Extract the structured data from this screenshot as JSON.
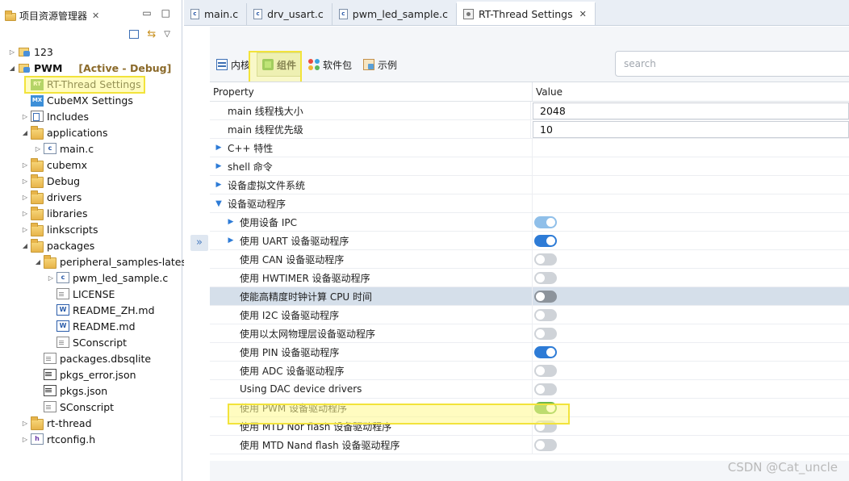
{
  "explorer": {
    "title": "项目资源管理器",
    "tree": [
      {
        "label": "123",
        "icon": "project-icon",
        "level": 0,
        "twisty": "▷"
      },
      {
        "label": "PWM",
        "icon": "project-icon",
        "level": 0,
        "twisty": "◢",
        "decoration": "[Active - Debug]",
        "bold": true
      },
      {
        "label": "RT-Thread Settings",
        "icon": "rt-thread-settings-icon",
        "level": 1,
        "twisty": ""
      },
      {
        "label": "CubeMX Settings",
        "icon": "cubemx-icon",
        "level": 1,
        "twisty": ""
      },
      {
        "label": "Includes",
        "icon": "includes-icon",
        "level": 1,
        "twisty": "▷"
      },
      {
        "label": "applications",
        "icon": "folder-icon",
        "level": 1,
        "twisty": "◢"
      },
      {
        "label": "main.c",
        "icon": "c-file-icon",
        "level": 2,
        "twisty": "▷"
      },
      {
        "label": "cubemx",
        "icon": "folder-icon",
        "level": 1,
        "twisty": "▷"
      },
      {
        "label": "Debug",
        "icon": "folder-icon",
        "level": 1,
        "twisty": "▷"
      },
      {
        "label": "drivers",
        "icon": "folder-icon",
        "level": 1,
        "twisty": "▷"
      },
      {
        "label": "libraries",
        "icon": "folder-icon",
        "level": 1,
        "twisty": "▷"
      },
      {
        "label": "linkscripts",
        "icon": "folder-icon",
        "level": 1,
        "twisty": "▷"
      },
      {
        "label": "packages",
        "icon": "folder-icon",
        "level": 1,
        "twisty": "◢"
      },
      {
        "label": "peripheral_samples-latest",
        "icon": "folder-icon",
        "level": 2,
        "twisty": "◢"
      },
      {
        "label": "pwm_led_sample.c",
        "icon": "c-file-icon",
        "level": 3,
        "twisty": "▷"
      },
      {
        "label": "LICENSE",
        "icon": "document-icon",
        "level": 3,
        "twisty": ""
      },
      {
        "label": "README_ZH.md",
        "icon": "word-file-icon",
        "level": 3,
        "twisty": ""
      },
      {
        "label": "README.md",
        "icon": "word-file-icon",
        "level": 3,
        "twisty": ""
      },
      {
        "label": "SConscript",
        "icon": "document-icon",
        "level": 3,
        "twisty": ""
      },
      {
        "label": "packages.dbsqlite",
        "icon": "document-icon",
        "level": 2,
        "twisty": ""
      },
      {
        "label": "pkgs_error.json",
        "icon": "json-file-icon",
        "level": 2,
        "twisty": ""
      },
      {
        "label": "pkgs.json",
        "icon": "json-file-icon",
        "level": 2,
        "twisty": ""
      },
      {
        "label": "SConscript",
        "icon": "document-icon",
        "level": 2,
        "twisty": ""
      },
      {
        "label": "rt-thread",
        "icon": "folder-icon",
        "level": 1,
        "twisty": "▷"
      },
      {
        "label": "rtconfig.h",
        "icon": "h-file-icon",
        "level": 1,
        "twisty": "▷"
      }
    ]
  },
  "editor_tabs": [
    {
      "label": "main.c",
      "icon": "c-file-icon",
      "active": false
    },
    {
      "label": "drv_usart.c",
      "icon": "c-file-icon",
      "active": false
    },
    {
      "label": "pwm_led_sample.c",
      "icon": "c-file-icon",
      "active": false
    },
    {
      "label": "RT-Thread Settings",
      "icon": "settings-icon",
      "active": true
    }
  ],
  "categories": [
    {
      "label": "内核",
      "icon": "kernel-icon",
      "selected": false
    },
    {
      "label": "组件",
      "icon": "component-icon",
      "selected": true
    },
    {
      "label": "软件包",
      "icon": "package-icon",
      "selected": false
    },
    {
      "label": "示例",
      "icon": "example-icon",
      "selected": false
    }
  ],
  "search": {
    "placeholder": "search"
  },
  "grid": {
    "header": {
      "property": "Property",
      "value": "Value"
    },
    "rows": [
      {
        "label": "main 线程栈大小",
        "indent": 1,
        "expander": "",
        "value_type": "text",
        "value": "2048"
      },
      {
        "label": "main 线程优先级",
        "indent": 1,
        "expander": "",
        "value_type": "text",
        "value": "10"
      },
      {
        "label": "C++ 特性",
        "indent": 0,
        "expander": "▶",
        "value_type": "none"
      },
      {
        "label": "shell 命令",
        "indent": 0,
        "expander": "▶",
        "value_type": "none"
      },
      {
        "label": "设备虚拟文件系统",
        "indent": 0,
        "expander": "▶",
        "value_type": "none"
      },
      {
        "label": "设备驱动程序",
        "indent": 0,
        "expander": "▼",
        "value_type": "none"
      },
      {
        "label": "使用设备 IPC",
        "indent": 1,
        "expander": "▶",
        "value_type": "toggle",
        "state": "onlight"
      },
      {
        "label": "使用 UART 设备驱动程序",
        "indent": 1,
        "expander": "▶",
        "value_type": "toggle",
        "state": "on"
      },
      {
        "label": "使用 CAN 设备驱动程序",
        "indent": 1,
        "expander": "",
        "value_type": "toggle",
        "state": "off"
      },
      {
        "label": "使用 HWTIMER 设备驱动程序",
        "indent": 1,
        "expander": "",
        "value_type": "toggle",
        "state": "off"
      },
      {
        "label": "使能高精度时钟计算 CPU 时间",
        "indent": 1,
        "expander": "",
        "value_type": "toggle",
        "state": "off-dark",
        "selected": true
      },
      {
        "label": "使用 I2C 设备驱动程序",
        "indent": 1,
        "expander": "",
        "value_type": "toggle",
        "state": "off"
      },
      {
        "label": "使用以太网物理层设备驱动程序",
        "indent": 1,
        "expander": "",
        "value_type": "toggle",
        "state": "off"
      },
      {
        "label": "使用 PIN 设备驱动程序",
        "indent": 1,
        "expander": "",
        "value_type": "toggle",
        "state": "on"
      },
      {
        "label": "使用 ADC 设备驱动程序",
        "indent": 1,
        "expander": "",
        "value_type": "toggle",
        "state": "off"
      },
      {
        "label": "Using DAC device drivers",
        "indent": 1,
        "expander": "",
        "value_type": "toggle",
        "state": "off"
      },
      {
        "label": "使用 PWM 设备驱动程序",
        "indent": 1,
        "expander": "",
        "value_type": "toggle",
        "state": "ongreen"
      },
      {
        "label": "使用 MTD Nor flash 设备驱动程序",
        "indent": 1,
        "expander": "",
        "value_type": "toggle",
        "state": "off"
      },
      {
        "label": "使用 MTD Nand flash 设备驱动程序",
        "indent": 1,
        "expander": "",
        "value_type": "toggle",
        "state": "off"
      }
    ]
  },
  "watermark": "CSDN @Cat_uncle",
  "colors": {
    "accent": "#2d7bd6",
    "highlight": "#f2e33b",
    "toggle_green": "#6db84a"
  }
}
